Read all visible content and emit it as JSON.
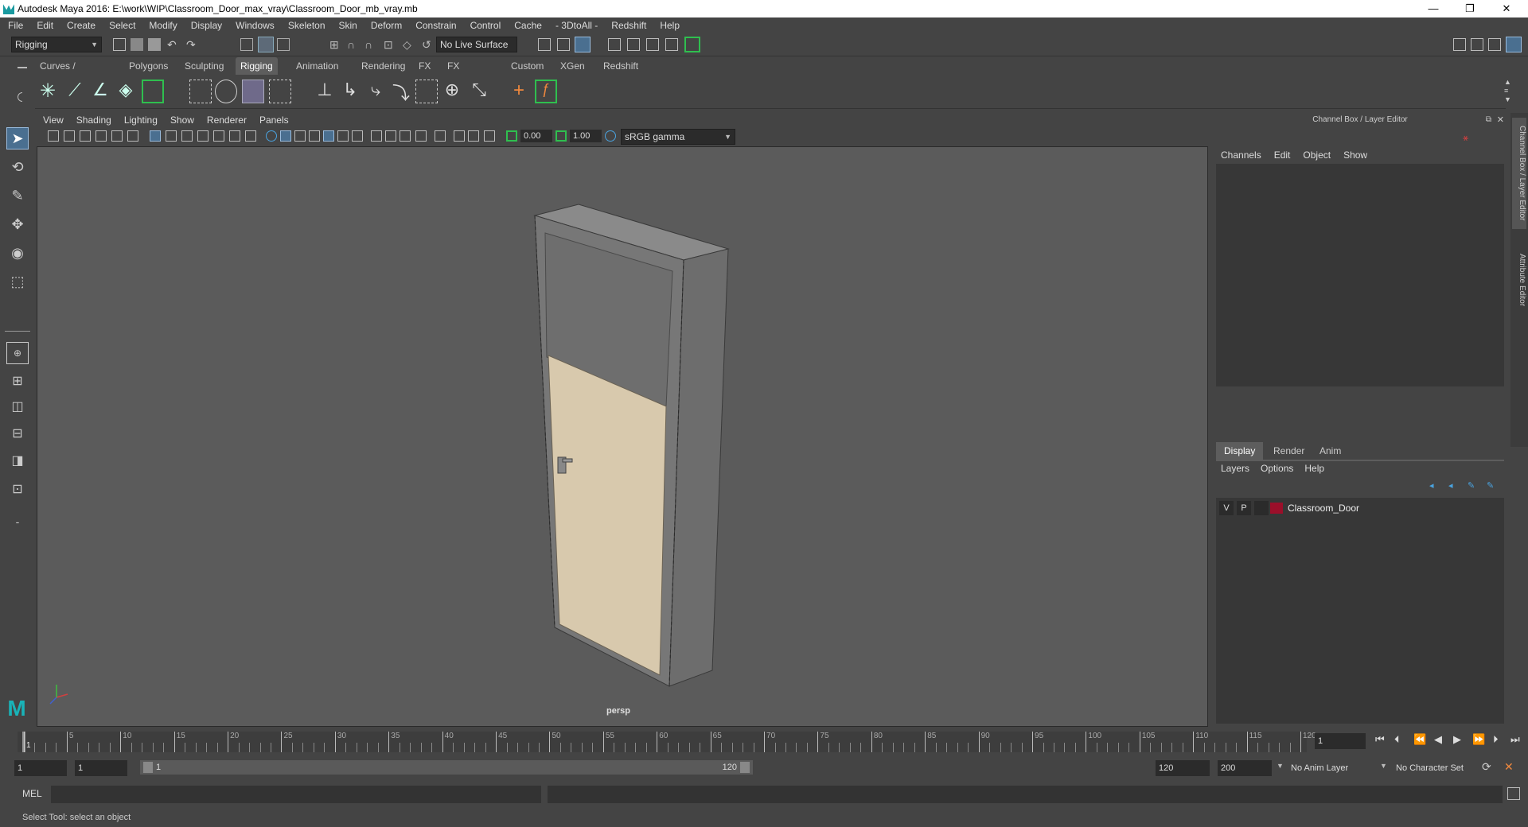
{
  "window": {
    "title": "Autodesk Maya 2016: E:\\work\\WIP\\Classroom_Door_max_vray\\Classroom_Door_mb_vray.mb",
    "minimize": "—",
    "restore": "❐",
    "close": "✕"
  },
  "menubar": [
    "File",
    "Edit",
    "Create",
    "Select",
    "Modify",
    "Display",
    "Windows",
    "Skeleton",
    "Skin",
    "Deform",
    "Constrain",
    "Control",
    "Cache",
    "- 3DtoAll -",
    "Redshift",
    "Help"
  ],
  "statusline": {
    "menu_set": "Rigging",
    "live_surface": "No Live Surface"
  },
  "shelf": {
    "tabs": [
      "Curves / Surfaces",
      "Polygons",
      "Sculpting",
      "Rigging",
      "Animation",
      "Rendering",
      "FX",
      "FX Caching",
      "Custom",
      "XGen",
      "Redshift"
    ],
    "active_tab": "Rigging"
  },
  "panel": {
    "menu": [
      "View",
      "Shading",
      "Lighting",
      "Show",
      "Renderer",
      "Panels"
    ],
    "exposure": "0.00",
    "gamma": "1.00",
    "color_space": "sRGB gamma",
    "camera_label": "persp"
  },
  "channel_box": {
    "title": "Channel Box / Layer Editor",
    "menu": [
      "Channels",
      "Edit",
      "Object",
      "Show"
    ],
    "side_tabs": [
      "Channel Box / Layer Editor",
      "Attribute Editor"
    ]
  },
  "layer_editor": {
    "tabs": [
      "Display",
      "Render",
      "Anim"
    ],
    "active_tab": "Display",
    "menu": [
      "Layers",
      "Options",
      "Help"
    ],
    "layers": [
      {
        "visible": "V",
        "playback": "P",
        "name": "Classroom_Door",
        "color": "#9b0f2a"
      }
    ]
  },
  "timeline": {
    "ticks": [
      1,
      5,
      10,
      15,
      20,
      25,
      30,
      35,
      40,
      45,
      50,
      55,
      60,
      65,
      70,
      75,
      80,
      85,
      90,
      95,
      100,
      105,
      110,
      115,
      120
    ],
    "current_frame": "1"
  },
  "range": {
    "start": "1",
    "playback_start": "1",
    "slider_start": "1",
    "slider_end": "120",
    "playback_end": "120",
    "end": "200",
    "anim_layer": "No Anim Layer",
    "character_set": "No Character Set"
  },
  "command_line": {
    "label": "MEL"
  },
  "help_line": {
    "text": "Select Tool: select an object"
  },
  "colors": {
    "accent_green": "#2fbf4f",
    "accent_blue": "#4aa3df",
    "active_tab": "#5d5d5d",
    "door_wood": "#d8c9ad",
    "frame_gray": "#7e7e7e"
  }
}
